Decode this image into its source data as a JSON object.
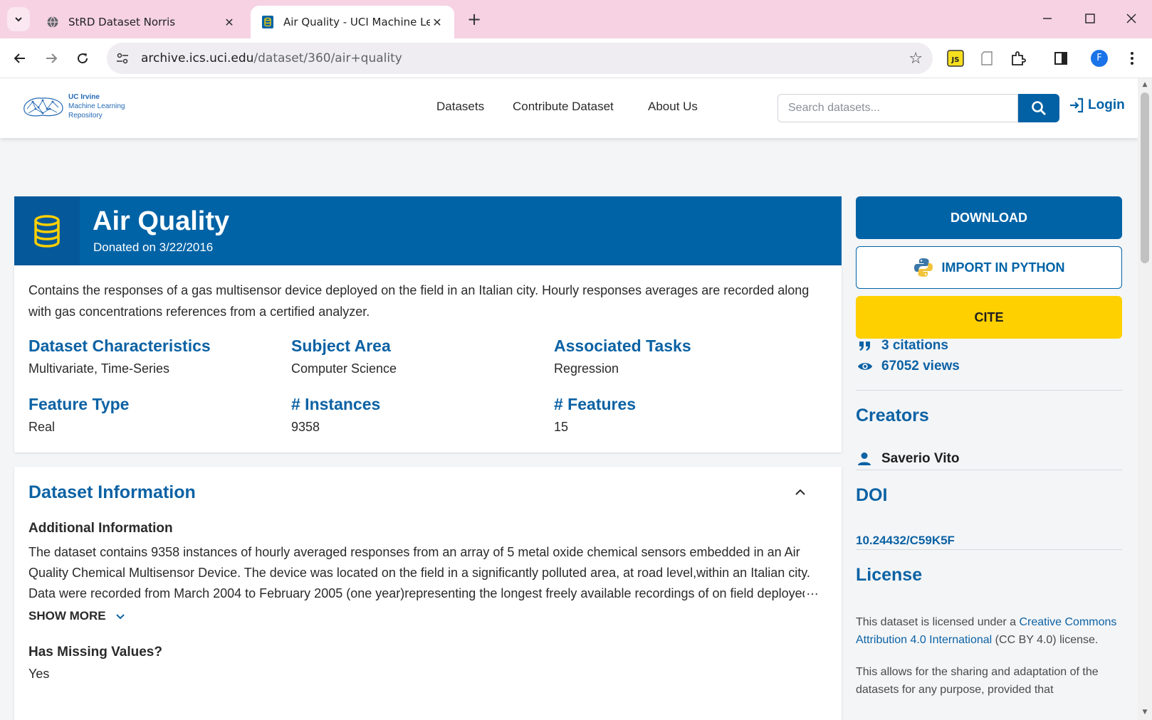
{
  "browser": {
    "tabs": [
      {
        "title": "StRD Dataset Norris",
        "active": false
      },
      {
        "title": "Air Quality - UCI Machine Lear",
        "active": true
      }
    ],
    "url_host": "archive.ics.uci.edu",
    "url_path": "/dataset/360/air+quality",
    "profile_initial": "F"
  },
  "site": {
    "logo_line1": "UC Irvine",
    "logo_line2": "Machine Learning",
    "logo_line3": "Repository",
    "nav": [
      "Datasets",
      "Contribute Dataset",
      "About Us"
    ],
    "search_placeholder": "Search datasets...",
    "login_label": "Login"
  },
  "dataset": {
    "title": "Air Quality",
    "donated": "Donated on 3/22/2016",
    "abstract": "Contains the responses of a gas multisensor device deployed on the field in an Italian city. Hourly responses averages are recorded along with gas concentrations references from a certified analyzer.",
    "characteristics": [
      {
        "label": "Dataset Characteristics",
        "value": "Multivariate, Time-Series"
      },
      {
        "label": "Subject Area",
        "value": "Computer Science"
      },
      {
        "label": "Associated Tasks",
        "value": "Regression"
      },
      {
        "label": "Feature Type",
        "value": "Real"
      },
      {
        "label": "# Instances",
        "value": "9358"
      },
      {
        "label": "# Features",
        "value": "15"
      }
    ],
    "info": {
      "section_title": "Dataset Information",
      "additional_heading": "Additional Information",
      "additional_text": "The dataset contains 9358 instances of hourly averaged responses from an array of 5 metal oxide chemical sensors embedded in an Air Quality Chemical Multisensor Device. The device was located on the field in a significantly polluted area, at road level,within an Italian city. Data were recorded from March 2004 to February 2005 (one year)representing the longest freely available recordings of on field deployed air quality chemical sensor devices responses.",
      "ellipsis": "…",
      "show_more": "SHOW MORE",
      "missing_heading": "Has Missing Values?",
      "missing_value": "Yes"
    }
  },
  "sidebar": {
    "download": "DOWNLOAD",
    "import_python": "IMPORT IN PYTHON",
    "cite": "CITE",
    "citations": "3 citations",
    "views": "67052 views",
    "creators_heading": "Creators",
    "creator": "Saverio Vito",
    "doi_heading": "DOI",
    "doi": "10.24432/C59K5F",
    "license_heading": "License",
    "license_pre": "This dataset is licensed under a ",
    "license_link": "Creative Commons Attribution 4.0 International",
    "license_post": " (CC BY 4.0) license.",
    "license_more": "This allows for the sharing and adaptation of the datasets for any purpose, provided that"
  },
  "colors": {
    "brand_blue": "#0063a6",
    "cite_yellow": "#ffd000",
    "tab_strip": "#f6d2e3"
  },
  "icons": [
    "chevron-down-icon",
    "globe-icon",
    "database-icon",
    "close-icon",
    "plus-icon",
    "minimize-icon",
    "maximize-icon",
    "back-icon",
    "forward-icon",
    "reload-icon",
    "site-info-icon",
    "star-icon",
    "js-extension-icon",
    "page-icon",
    "puzzle-icon",
    "sidepanel-icon",
    "more-icon",
    "search-icon",
    "login-icon",
    "python-icon",
    "quote-icon",
    "eye-icon",
    "person-icon",
    "chevron-up-icon"
  ]
}
